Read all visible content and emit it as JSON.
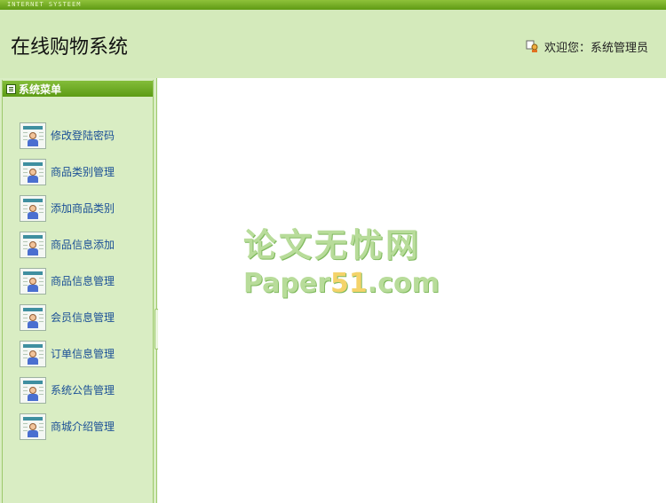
{
  "topbar": {
    "text": "INTERNET SYSTEEM"
  },
  "header": {
    "title": "在线购物系统",
    "welcome": "欢迎您：系统管理员"
  },
  "sidebar": {
    "heading": "系统菜单",
    "items": [
      {
        "label": "修改登陆密码"
      },
      {
        "label": "商品类别管理"
      },
      {
        "label": "添加商品类别"
      },
      {
        "label": "商品信息添加"
      },
      {
        "label": "商品信息管理"
      },
      {
        "label": "会员信息管理"
      },
      {
        "label": "订单信息管理"
      },
      {
        "label": "系统公告管理"
      },
      {
        "label": "商城介绍管理"
      }
    ]
  },
  "watermark": {
    "cn": "论文无忧网",
    "en_prefix": "Paper",
    "en_highlight": "51",
    "en_suffix": ".com"
  },
  "colors": {
    "topbar": "#6aa61f",
    "header_bg": "#d4eabb",
    "sidebar_bg": "#d9edc3",
    "link": "#1a4f96"
  }
}
